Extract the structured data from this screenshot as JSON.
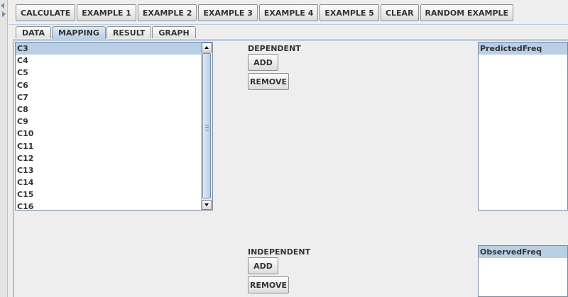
{
  "toolbar": {
    "buttons": [
      "CALCULATE",
      "EXAMPLE 1",
      "EXAMPLE 2",
      "EXAMPLE 3",
      "EXAMPLE 4",
      "EXAMPLE 5",
      "CLEAR",
      "RANDOM EXAMPLE"
    ]
  },
  "tabs": [
    "DATA",
    "MAPPING",
    "RESULT",
    "GRAPH"
  ],
  "active_tab": "MAPPING",
  "variable_list": {
    "items": [
      "C3",
      "C4",
      "C5",
      "C6",
      "C7",
      "C8",
      "C9",
      "C10",
      "C11",
      "C12",
      "C13",
      "C14",
      "C15",
      "C16"
    ],
    "selected": "C3"
  },
  "dependent": {
    "label": "DEPENDENT",
    "add_label": "ADD",
    "remove_label": "REMOVE",
    "list_header": "PredictedFreq"
  },
  "independent": {
    "label": "INDEPENDENT",
    "add_label": "ADD",
    "remove_label": "REMOVE",
    "list_header": "ObservedFreq"
  },
  "colors": {
    "selection": "#b8cfe5",
    "background": "#eeeeee"
  }
}
